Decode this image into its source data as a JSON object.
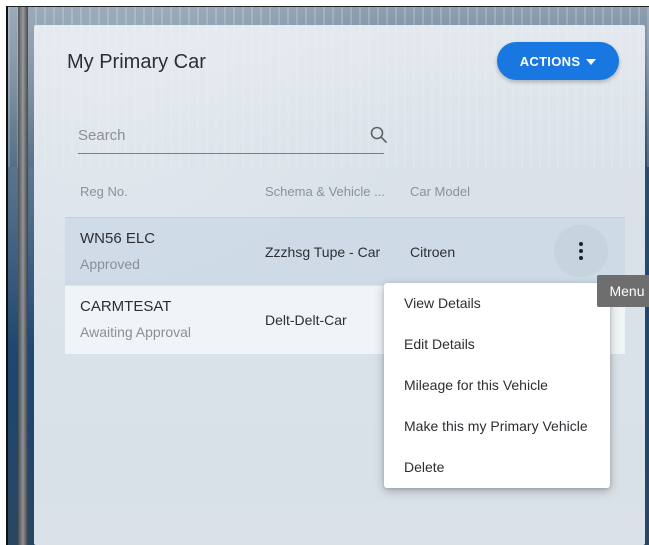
{
  "card": {
    "title": "My Primary Car",
    "actions_label": "ACTIONS"
  },
  "search": {
    "placeholder": "Search",
    "value": ""
  },
  "table": {
    "columns": [
      "Reg No.",
      "Schema & Vehicle ...",
      "Car Model"
    ],
    "rows": [
      {
        "reg": "WN56 ELC",
        "status": "Approved",
        "schema": "Zzzhsg Tupe - Car",
        "model": "Citroen"
      },
      {
        "reg": "CARMTESAT",
        "status": "Awaiting Approval",
        "schema": "Delt-Delt-Car",
        "model": ""
      }
    ]
  },
  "tooltip": {
    "text": "Menu"
  },
  "menu": {
    "items": [
      "View Details",
      "Edit Details",
      "Mileage for this Vehicle",
      "Make this my Primary Vehicle",
      "Delete"
    ]
  },
  "icons": {
    "search": "search-icon",
    "actions": "caret-down-icon",
    "row_menu": "more-vertical-icon"
  },
  "colors": {
    "accent": "#1877e0",
    "selected_row": "#cddae5",
    "tooltip_bg": "#6e6e6e"
  }
}
